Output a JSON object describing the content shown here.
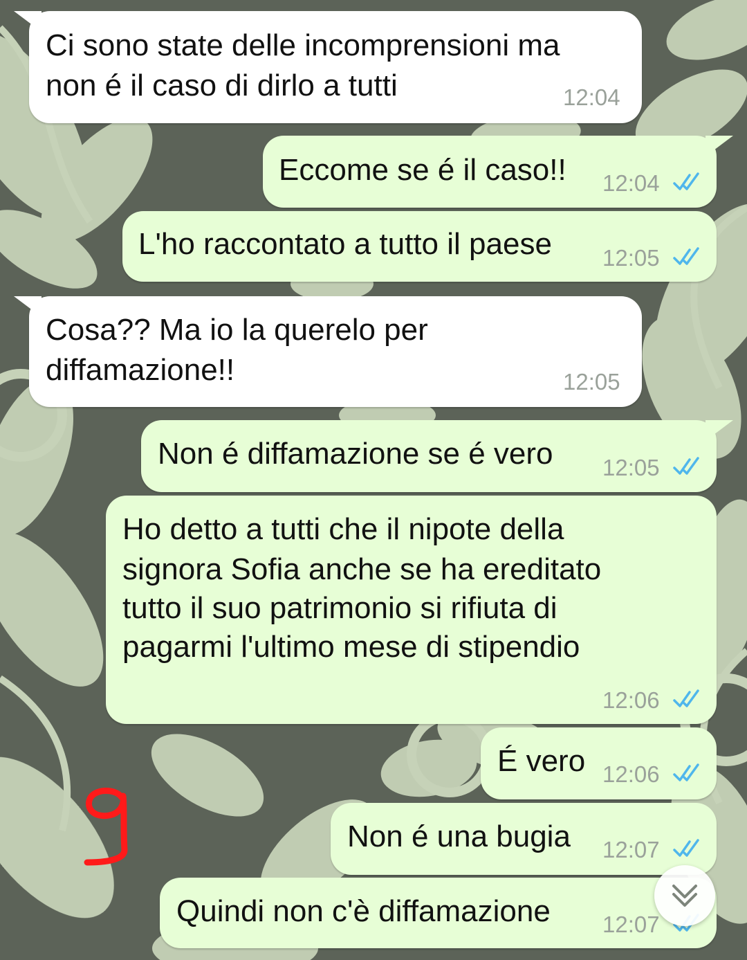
{
  "chat": {
    "messages": [
      {
        "direction": "in",
        "lines": [
          "Ci sono state delle incomprensioni ma",
          "non é il caso di dirlo a tutti"
        ],
        "time": "12:04"
      },
      {
        "direction": "out",
        "lines": [
          "Eccome se é il caso!!"
        ],
        "time": "12:04",
        "status": "read"
      },
      {
        "direction": "out",
        "lines": [
          "L'ho raccontato a tutto il paese"
        ],
        "time": "12:05",
        "status": "read"
      },
      {
        "direction": "in",
        "lines": [
          "Cosa?? Ma io la querelo per",
          "diffamazione!!"
        ],
        "time": "12:05"
      },
      {
        "direction": "out",
        "lines": [
          "Non é diffamazione se é vero"
        ],
        "time": "12:05",
        "status": "read"
      },
      {
        "direction": "out",
        "lines": [
          "Ho detto a tutti che il nipote della",
          "signora Sofia anche se ha ereditato",
          "tutto il suo patrimonio si rifiuta di",
          "pagarmi l'ultimo mese di stipendio"
        ],
        "time": "12:06",
        "status": "read"
      },
      {
        "direction": "out",
        "lines": [
          "É vero"
        ],
        "time": "12:06",
        "status": "read"
      },
      {
        "direction": "out",
        "lines": [
          "Non é una bugia"
        ],
        "time": "12:07",
        "status": "read"
      },
      {
        "direction": "out",
        "lines": [
          "Quindi non c'è diffamazione"
        ],
        "time": "12:07",
        "status": "read"
      }
    ]
  },
  "colors": {
    "wallpaper": "#5c6358",
    "wallpaper_leaf": "#c6d2b8",
    "incoming_bubble": "#ffffff",
    "outgoing_bubble": "#e7fed6",
    "read_ticks": "#4fb6ec",
    "timestamp": "#9aa19a",
    "annotation": "#ff1a1a"
  },
  "icons": {
    "read_receipt": "double-check-icon",
    "scroll_down": "chevron-double-down-icon",
    "annotation_mark": "red-handwritten-mark"
  }
}
